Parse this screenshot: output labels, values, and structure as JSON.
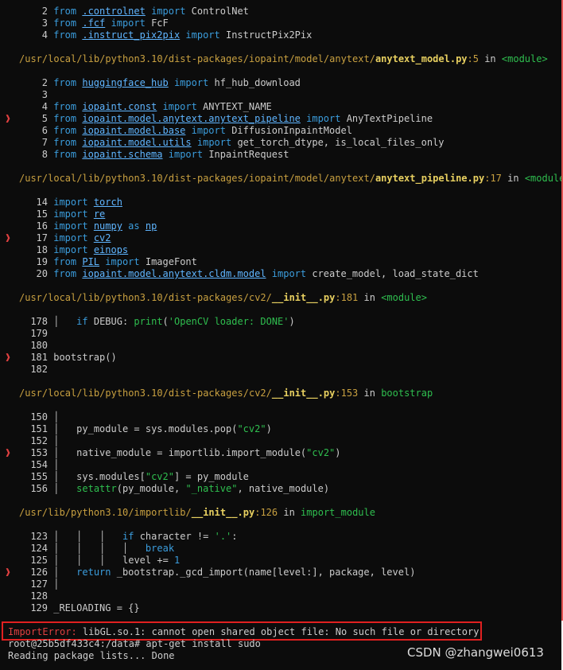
{
  "traceback": {
    "frame0": {
      "lines": [
        {
          "n": "2",
          "a": "from ",
          "m": ".controlnet",
          "b": " import ",
          "c": "ControlNet"
        },
        {
          "n": "3",
          "a": "from ",
          "m": ".fcf",
          "b": " import ",
          "c": "FcF"
        },
        {
          "n": "4",
          "a": "from ",
          "m": ".instruct_pix2pix",
          "b": " import ",
          "c": "InstructPix2Pix"
        }
      ]
    },
    "frame1": {
      "path": "/usr/local/lib/python3.10/dist-packages/iopaint/model/anytext/",
      "file": "anytext_model.py",
      "lineno": ":5",
      "in": " in ",
      "func": "<module>",
      "lines": [
        {
          "n": "2",
          "a": "from ",
          "m": "huggingface_hub",
          "b": " import ",
          "c": "hf_hub_download"
        },
        {
          "n": "3"
        },
        {
          "n": "4",
          "a": "from ",
          "m": "iopaint.const",
          "b": " import ",
          "c": "ANYTEXT_NAME"
        },
        {
          "n": "5",
          "a": "from ",
          "m": "iopaint.model.anytext.anytext_pipeline",
          "b": " import ",
          "c": "AnyTextPipeline"
        },
        {
          "n": "6",
          "a": "from ",
          "m": "iopaint.model.base",
          "b": " import ",
          "c": "DiffusionInpaintModel"
        },
        {
          "n": "7",
          "a": "from ",
          "m": "iopaint.model.utils",
          "b": " import ",
          "c": "get_torch_dtype, is_local_files_only"
        },
        {
          "n": "8",
          "a": "from ",
          "m": "iopaint.schema",
          "b": " import ",
          "c": "InpaintRequest"
        }
      ]
    },
    "frame2": {
      "path": "/usr/local/lib/python3.10/dist-packages/iopaint/model/anytext/",
      "file": "anytext_pipeline.py",
      "lineno": ":17",
      "in": " in ",
      "func": "<module>",
      "lines": [
        {
          "n": "14",
          "a": "import ",
          "m": "torch"
        },
        {
          "n": "15",
          "a": "import ",
          "m": "re"
        },
        {
          "n": "16",
          "a": "import ",
          "m": "numpy",
          "b": " as ",
          "m2": "np"
        },
        {
          "n": "17",
          "a": "import ",
          "m": "cv2"
        },
        {
          "n": "18",
          "a": "import ",
          "m": "einops"
        },
        {
          "n": "19",
          "a": "from ",
          "m": "PIL",
          "b": " import ",
          "c": "ImageFont"
        },
        {
          "n": "20",
          "a": "from ",
          "m": "iopaint.model.anytext.cldm.model",
          "b": " import ",
          "c": "create_model, load_state_dict"
        }
      ]
    },
    "frame3": {
      "path": "/usr/local/lib/python3.10/dist-packages/cv2/",
      "file": "__init__.py",
      "lineno": ":181",
      "in": " in ",
      "func": "<module>",
      "l178_n": "178",
      "l178_kw": "if ",
      "l178_c": "DEBUG: ",
      "l178_fn": "print",
      "l178_p": "(",
      "l178_s": "'OpenCV loader: DONE'",
      "l178_e": ")",
      "l179_n": "179",
      "l180_n": "180",
      "l181_n": "181",
      "l181_c": "bootstrap()",
      "l182_n": "182"
    },
    "frame4": {
      "path": "/usr/local/lib/python3.10/dist-packages/cv2/",
      "file": "__init__.py",
      "lineno": ":153",
      "in": " in ",
      "func": "bootstrap",
      "l150_n": "150",
      "l151_n": "151",
      "l151_a": "py_module = sys.modules.pop(",
      "l151_s": "\"cv2\"",
      "l151_e": ")",
      "l152_n": "152",
      "l153_n": "153",
      "l153_a": "native_module = importlib.import_module(",
      "l153_s": "\"cv2\"",
      "l153_e": ")",
      "l154_n": "154",
      "l155_n": "155",
      "l155_a": "sys.modules[",
      "l155_s": "\"cv2\"",
      "l155_e": "] = py_module",
      "l156_n": "156",
      "l156_fn": "setattr",
      "l156_a": "(py_module, ",
      "l156_s": "\"_native\"",
      "l156_e": ", native_module)"
    },
    "frame5": {
      "path": "/usr/lib/python3.10/importlib/",
      "file": "__init__.py",
      "lineno": ":126",
      "in": " in ",
      "func": "import_module",
      "l123_n": "123",
      "l123_kw": "if ",
      "l123_a": "character != ",
      "l123_s": "'.'",
      "l123_e": ":",
      "l124_n": "124",
      "l124_kw": "break",
      "l125_n": "125",
      "l125_a": "level += ",
      "l125_num": "1",
      "l126_n": "126",
      "l126_kw": "return ",
      "l126_a": "_bootstrap._gcd_import(name[level:], package, level)",
      "l127_n": "127",
      "l128_n": "128",
      "l129_n": "129",
      "l129_a": "_RELOADING = {}"
    }
  },
  "error": {
    "type": "ImportError:",
    "message": " libGL.so.1: cannot open shared object file: No such file or directory"
  },
  "shell": {
    "prompt_line": "root@25b5df433c4:/data# apt-get install sudo",
    "output_line": "Reading package lists... Done"
  },
  "watermark": "CSDN @zhangwei0613",
  "colors": {
    "error_marker": "#e04040",
    "keyword": "#3b9ddd",
    "string": "#2fbf4f",
    "path": "#c8a040",
    "file": "#e8d060"
  }
}
